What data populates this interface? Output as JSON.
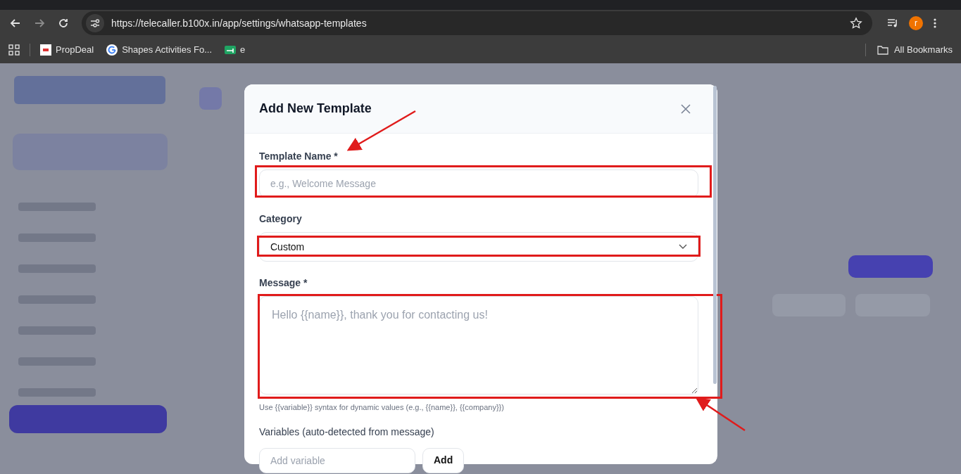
{
  "browser": {
    "url": "https://telecaller.b100x.in/app/settings/whatsapp-templates",
    "profile_initial": "r",
    "bookmarks": [
      {
        "label": "PropDeal",
        "kind": "propdeal"
      },
      {
        "label": "Shapes Activities Fo...",
        "kind": "google"
      },
      {
        "label": "e",
        "kind": "green"
      }
    ],
    "all_bookmarks": "All Bookmarks"
  },
  "modal": {
    "title": "Add New Template",
    "fields": [
      {
        "kind": "input",
        "label": "Template Name *",
        "placeholder": "e.g., Welcome Message",
        "highlighted": true
      },
      {
        "kind": "select",
        "label": "Category",
        "value": "Custom",
        "highlighted": true
      },
      {
        "kind": "textarea",
        "label": "Message *",
        "placeholder": "Hello {{name}}, thank you for contacting us!",
        "hint": "Use {{variable}} syntax for dynamic values (e.g., {{name}}, {{company}})",
        "highlighted": true
      }
    ],
    "variables": {
      "label": "Variables (auto-detected from message)",
      "placeholder": "Add variable",
      "button": "Add"
    }
  }
}
